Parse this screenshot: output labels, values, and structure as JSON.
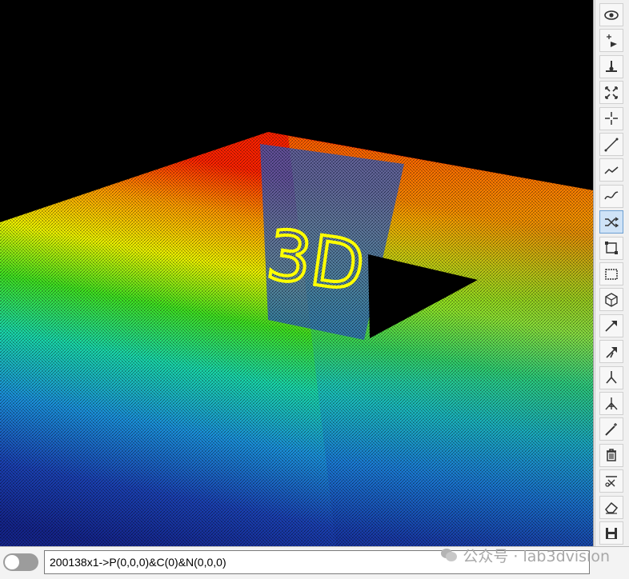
{
  "viewport": {
    "background": "#000000",
    "logo_text": "3D",
    "logo_color": "#ffff00"
  },
  "toolbar": {
    "tools": [
      {
        "name": "view-icon"
      },
      {
        "name": "pick-point-icon"
      },
      {
        "name": "ground-pin-icon"
      },
      {
        "name": "fit-view-icon"
      },
      {
        "name": "crosshair-icon"
      },
      {
        "name": "line-tool-icon"
      },
      {
        "name": "polyline-icon"
      },
      {
        "name": "curve-icon"
      },
      {
        "name": "shuffle-icon",
        "active": true
      },
      {
        "name": "plane-select-icon"
      },
      {
        "name": "rect-select-icon"
      },
      {
        "name": "cube-icon"
      },
      {
        "name": "arrow-icon"
      },
      {
        "name": "branch-arrow-icon"
      },
      {
        "name": "fork-icon"
      },
      {
        "name": "multi-fork-icon"
      },
      {
        "name": "wand-icon"
      },
      {
        "name": "trash-icon"
      },
      {
        "name": "cut-icon"
      },
      {
        "name": "eraser-icon"
      },
      {
        "name": "save-icon"
      }
    ]
  },
  "statusbar": {
    "command_value": "200138x1->P(0,0,0)&C(0)&N(0,0,0)",
    "toggle_on": false
  },
  "watermark": {
    "text": "公众号 · lab3dvision"
  }
}
